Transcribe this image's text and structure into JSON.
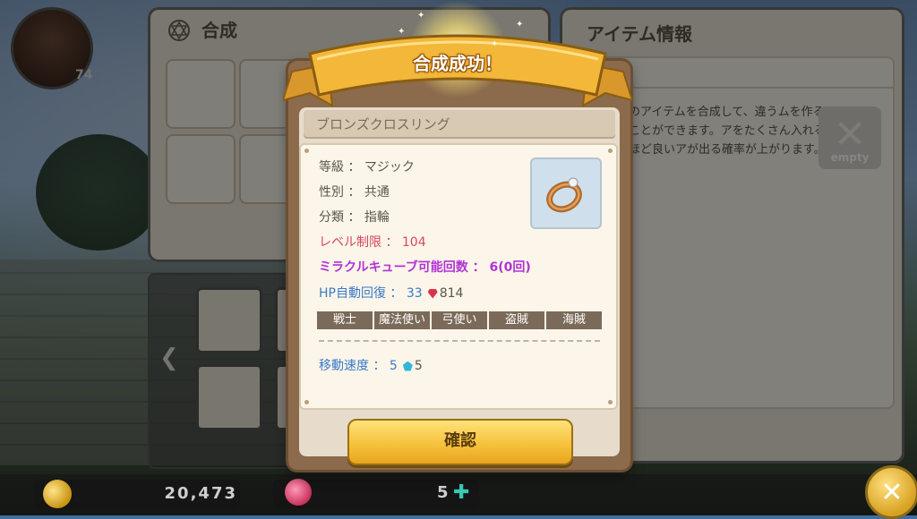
{
  "player": {
    "level": "74"
  },
  "synthesis_panel": {
    "title": "合成"
  },
  "item_info_panel": {
    "title": "アイテム情報",
    "description": "のアイテムを合成して、違うムを作ることができます。アをたくさん入れるほど良いアが出る確率が上がります。",
    "empty_label": "empty"
  },
  "popup": {
    "banner": "合成成功！",
    "item_name": "ブロンズクロスリング",
    "stats": {
      "grade": "等級 ： マジック",
      "gender": "性別 ： 共通",
      "category": "分類 ： 指輪",
      "level_limit": "レベル制限 ： 104",
      "miracle_cube": "ミラクルキューブ可能回数 ： 6(0回)",
      "hp_regen_label": "HP自動回復 ： 33",
      "hp_regen_bonus": "814",
      "move_speed_label": "移動速度 ： 5",
      "move_speed_bonus": "5"
    },
    "jobs": [
      "戦士",
      "魔法使い",
      "弓使い",
      "盗賊",
      "海賊"
    ],
    "confirm_label": "確認"
  },
  "currency": {
    "gold": "20,473",
    "candy": "5"
  },
  "colors": {
    "accent_gold": "#f6c23d",
    "level_limit": "#d9455f",
    "miracle": "#b233d6",
    "stat_blue": "#3b79c9"
  },
  "icons": [
    "hexagram-icon",
    "coin-icon",
    "candy-icon",
    "plus-icon",
    "close-icon",
    "ring-icon",
    "chevron-left-icon"
  ]
}
